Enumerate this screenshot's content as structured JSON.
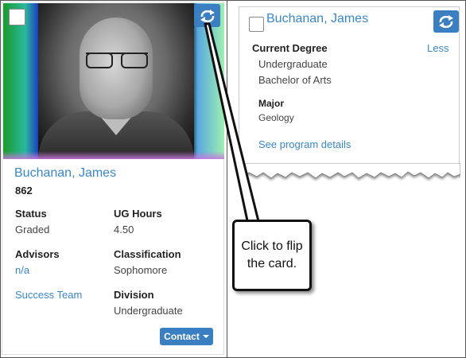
{
  "front": {
    "name": "Buchanan, James",
    "id": "862",
    "fields": {
      "status_label": "Status",
      "status_value": "Graded",
      "ug_hours_label": "UG Hours",
      "ug_hours_value": "4.50",
      "advisors_label": "Advisors",
      "advisors_value": "n/a",
      "classification_label": "Classification",
      "classification_value": "Sophomore",
      "success_team_link": "Success Team",
      "division_label": "Division",
      "division_value": "Undergraduate"
    },
    "contact_button": "Contact"
  },
  "back": {
    "name": "Buchanan, James",
    "less_link": "Less",
    "current_degree_label": "Current Degree",
    "degree_level": "Undergraduate",
    "degree_name": "Bachelor of Arts",
    "major_label": "Major",
    "major_value": "Geology",
    "program_details_link": "See program details"
  },
  "callout": {
    "line1": "Click to flip",
    "line2": "the card."
  },
  "colors": {
    "accent": "#3a7fc1",
    "link": "#3a87c8"
  },
  "icons": {
    "flip": "flip-arrows-icon",
    "checkbox": "checkbox-icon",
    "caret": "caret-down-icon"
  }
}
